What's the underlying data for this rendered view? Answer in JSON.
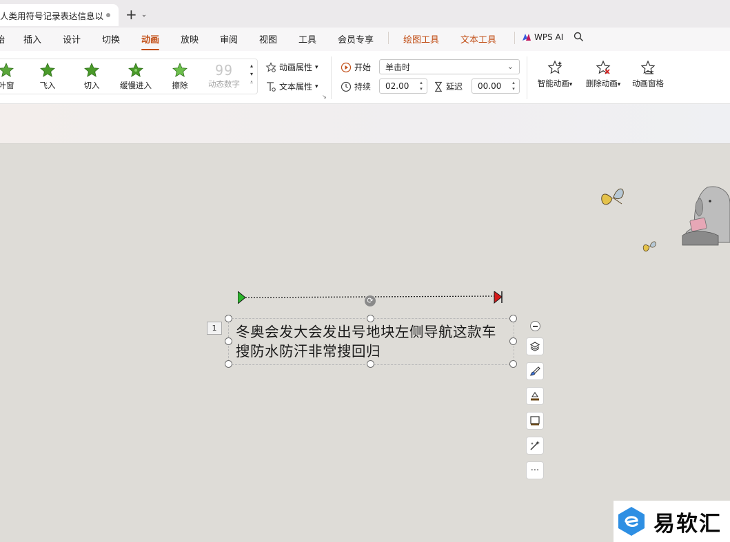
{
  "titlebar": {
    "document_tab": "人类用符号记录表达信息以",
    "new_tab_symbol": "+",
    "tab_menu_symbol": "⌄"
  },
  "menubar": {
    "partial_first": "始",
    "items": [
      "插入",
      "设计",
      "切换",
      "动画",
      "放映",
      "审阅",
      "视图",
      "工具",
      "会员专享"
    ],
    "active": "动画",
    "context_tabs": [
      "绘图工具",
      "文本工具"
    ],
    "ai_label": "WPS AI"
  },
  "ribbon": {
    "effects": [
      {
        "label": "叶窗"
      },
      {
        "label": "飞入"
      },
      {
        "label": "切入"
      },
      {
        "label": "缓慢进入"
      },
      {
        "label": "擦除"
      },
      {
        "label": "动态数字",
        "glyph": "99",
        "disabled": true
      }
    ],
    "anim_props": "动画属性",
    "text_props": "文本属性",
    "start_label": "开始",
    "start_value": "单击时",
    "duration_label": "持续",
    "duration_value": "02.00",
    "delay_label": "延迟",
    "delay_value": "00.00",
    "smart_anim": "智能动画",
    "delete_anim": "删除动画",
    "anim_pane": "动画窗格"
  },
  "slide": {
    "order_number": "1",
    "text_content": "冬奥会发大会发出号地块左侧导航这款车搜防水防汗非常搜回归",
    "float_tools": [
      "collapse-icon",
      "layers-icon",
      "brush-icon",
      "fill-icon",
      "frame-icon",
      "magic-icon",
      "more-icon"
    ],
    "more_label": "···"
  },
  "watermark": {
    "text": "易软汇"
  },
  "colors": {
    "accent": "#c24f17",
    "star_green": "#4a9a2a",
    "path_start": "#2bb52b",
    "path_end": "#d41a1a",
    "canvas": "#dedcd7"
  }
}
